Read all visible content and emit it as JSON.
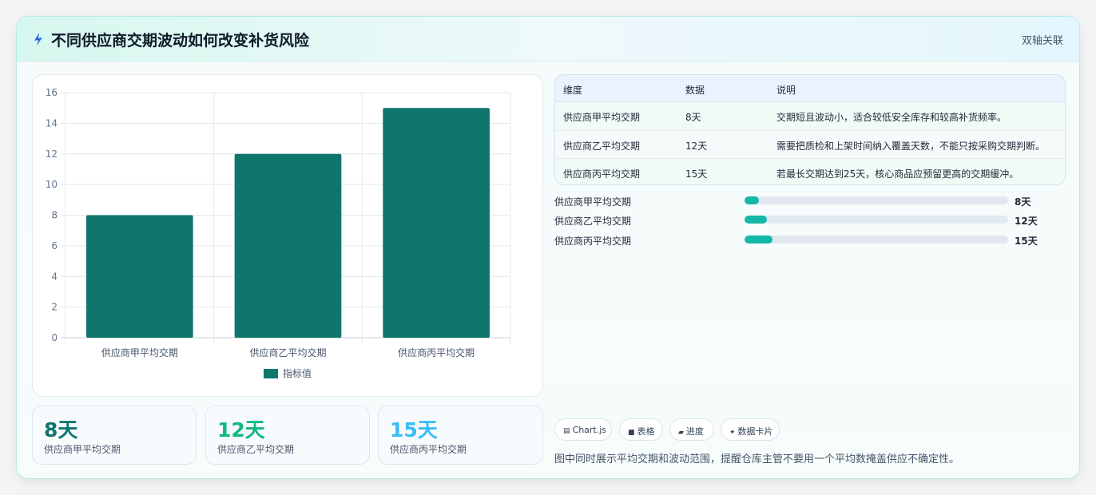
{
  "header": {
    "title": "不同供应商交期波动如何改变补货风险",
    "tag": "双轴关联",
    "icon": "bolt-icon"
  },
  "chart_data": {
    "type": "bar",
    "categories": [
      "供应商甲平均交期",
      "供应商乙平均交期",
      "供应商丙平均交期"
    ],
    "series": [
      {
        "name": "指标值",
        "values": [
          8,
          12,
          15
        ],
        "color": "#0f766e"
      }
    ],
    "ylim": [
      0,
      16
    ],
    "yticks": [
      0,
      2,
      4,
      6,
      8,
      10,
      12,
      14,
      16
    ],
    "grid": true,
    "legend": "bottom"
  },
  "stats": [
    {
      "value": "8天",
      "label": "供应商甲平均交期",
      "color": "#0f766e"
    },
    {
      "value": "12天",
      "label": "供应商乙平均交期",
      "color": "#10b981"
    },
    {
      "value": "15天",
      "label": "供应商丙平均交期",
      "color": "#38bdf8"
    }
  ],
  "table": {
    "headers": [
      "维度",
      "数据",
      "说明"
    ],
    "rows": [
      [
        "供应商甲平均交期",
        "8天",
        "交期短且波动小，适合较低安全库存和较高补货频率。"
      ],
      [
        "供应商乙平均交期",
        "12天",
        "需要把质检和上架时间纳入覆盖天数，不能只按采购交期判断。"
      ],
      [
        "供应商丙平均交期",
        "15天",
        "若最长交期达到25天，核心商品应预留更高的交期缓冲。"
      ]
    ]
  },
  "progress": [
    {
      "label": "供应商甲平均交期",
      "value": "8天",
      "fraction": 0.055
    },
    {
      "label": "供应商乙平均交期",
      "value": "12天",
      "fraction": 0.085
    },
    {
      "label": "供应商丙平均交期",
      "value": "15天",
      "fraction": 0.105
    }
  ],
  "chips": [
    {
      "icon": "chart-icon",
      "glyph": "▤",
      "label": "Chart.js"
    },
    {
      "icon": "table-icon",
      "glyph": "■",
      "label": "表格"
    },
    {
      "icon": "progress-icon",
      "glyph": "▰",
      "label": "进度"
    },
    {
      "icon": "sparkle-icon",
      "glyph": "✦",
      "label": "数据卡片"
    }
  ],
  "note": "图中同时展示平均交期和波动范围，提醒仓库主管不要用一个平均数掩盖供应不确定性。"
}
